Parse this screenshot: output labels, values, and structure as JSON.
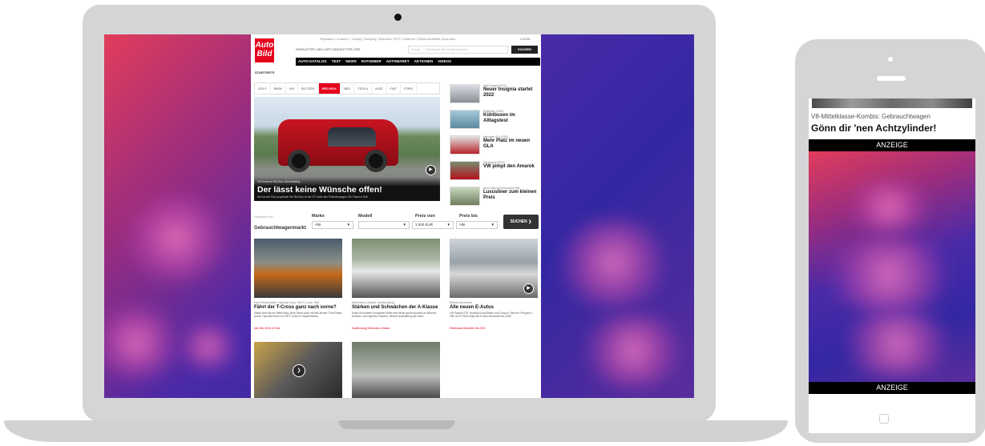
{
  "site": {
    "topnav": "Reparatur | Zubehör | Tuning | Camping | Motorrad | BTS | Oldtimer | Elektromobilität | Auto-Abo",
    "profile": "LOGIN",
    "sublinks": "NEWSLETTER | ABO | APP | NEWSLETTER | RSS",
    "search_placeholder": "Suchbegriff oder Modell eingeben",
    "search_prefix": "Google",
    "search_button": "SUCHEN",
    "main_nav": [
      "AUTO-KATALOG",
      "TEST",
      "NEWS",
      "RATGEBER",
      "AUTOMARKT",
      "AKTIONEN",
      "VIDEOS"
    ],
    "breadcrumb": "STARTSEITE",
    "filters": [
      "GOLF",
      "BMW",
      "VW",
      "BLITZER",
      "RED BOX",
      "NEU",
      "TESLA",
      "AUDI",
      "FIAT",
      "FORD"
    ],
    "active_filter": "RED BOX",
    "hero": {
      "kicker": "VW Amarok Red Box Werkstattlog",
      "title": "Der lässt keine Wünsche offen!",
      "teaser": "Mit Kat den Pick-up gebaut! Die Red Box ist der GTI unter den Pritschenwagen. Ein Traum in Rot!"
    },
    "side_news": [
      {
        "kicker": "Opel Insignia (2022)",
        "title": "Neuer Insignia startet 2022"
      },
      {
        "kicker": "Kühlboxen (2019)",
        "title": "Kühlboxen im Alltagstest"
      },
      {
        "kicker": "Mercedes GLA (2020)",
        "title": "Mehr Platz im neuen GLA"
      },
      {
        "kicker": "VW Amarok (2019)",
        "title": "VW pimpt den Amarok"
      },
      {
        "kicker": "Iveco Daily 4x4 Wohnmobil Test",
        "title": "Luxusliner zum kleinen Preis"
      }
    ],
    "market": {
      "label": "Präsentiert von",
      "title": "Gebrauchtwagenmarkt",
      "fields": [
        {
          "label": "Marke",
          "value": "Alle"
        },
        {
          "label": "Modell",
          "value": ""
        },
        {
          "label": "Preis von",
          "value": "1.000 EUR"
        },
        {
          "label": "Preis bis",
          "value": "Alle"
        }
      ],
      "button": "SUCHEN"
    },
    "cards": [
      {
        "kicker": "Ford Fiesta Active, Hyundai Kona, VW T-Cross: Test",
        "title": "Fährt der T-Cross ganz nach vorne?",
        "text": "Etwas mehr als ein Meter lang, dient Diesel auch mit Mini-Bumer. Ford Fiesta Active, Hyundai Kona und VW T-Cross im Vergleichstest.",
        "link": "Alle Mini-SUVs im Test"
      },
      {
        "kicker": "Mercedes A-Klasse: Kaufberatung",
        "title": "Stärken und Schwächen der A-Klasse",
        "text": "Kaum ein anderer Kompakter bietet eine derart große Auswahl an Motoren, Komfort- und Highend-Features. Welche Ausstattung sich lohnt.",
        "link": "Kaufberatung Mercedes A-Klasse"
      },
      {
        "kicker": "Elektro-Neuheiten",
        "title": "Alle neuen E-Autos",
        "text": "VW Passat GTE, Hyundai Ioniq Elektro und Corsa-e, Stromer, Peugeot e-208: AUTO BILD zeigt alle E-Auto-Neuheiten bis 2024!",
        "link": "Elektroauto-Neuheiten bis 2024"
      }
    ]
  },
  "phone": {
    "kicker": "V8-Mittelklasse-Kombis: Gebrauchtwagen",
    "title": "Gönn dir 'nen Achtzylinder!",
    "ad_label_top": "ANZEIGE",
    "ad_label_bottom": "ANZEIGE"
  },
  "colors": {
    "brand_red": "#e5001c",
    "ad_gradient_start": "#e23c5b",
    "ad_gradient_end": "#3327a3"
  }
}
